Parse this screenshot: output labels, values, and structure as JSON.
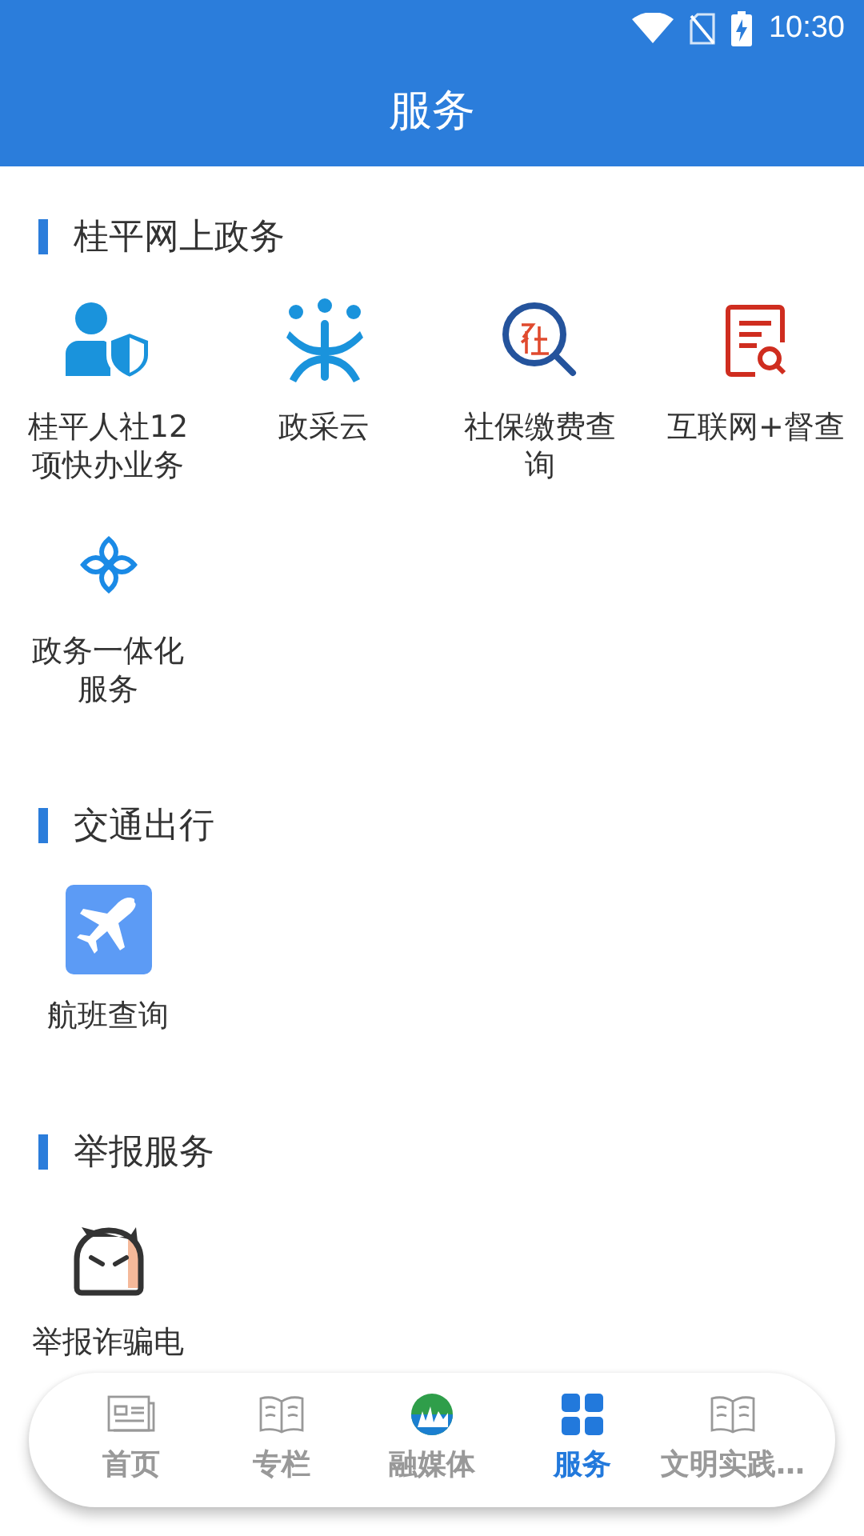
{
  "status_bar": {
    "time": "10:30"
  },
  "header": {
    "title": "服务"
  },
  "sections": [
    {
      "title": "桂平网上政务",
      "items": [
        {
          "label": "桂平人社12项快办业务"
        },
        {
          "label": "政采云"
        },
        {
          "label": "社保缴费查询"
        },
        {
          "label": "互联网+督查"
        },
        {
          "label": "政务一体化服务"
        }
      ]
    },
    {
      "title": "交通出行",
      "items": [
        {
          "label": "航班查询"
        }
      ]
    },
    {
      "title": "举报服务",
      "items": [
        {
          "label": "举报诈骗电"
        }
      ]
    }
  ],
  "bottom_nav": [
    {
      "label": "首页",
      "selected": false
    },
    {
      "label": "专栏",
      "selected": false
    },
    {
      "label": "融媒体",
      "selected": false
    },
    {
      "label": "服务",
      "selected": true
    },
    {
      "label": "文明实践…",
      "selected": false
    }
  ]
}
